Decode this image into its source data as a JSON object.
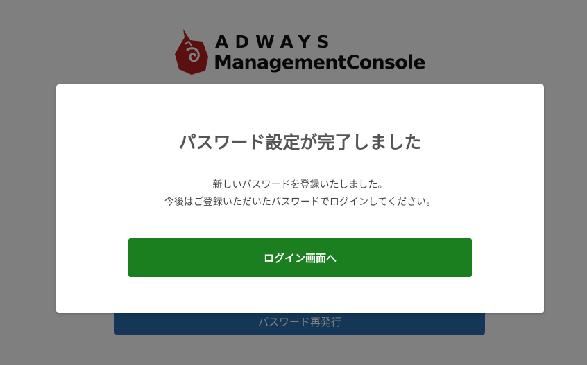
{
  "logo": {
    "brand": "ADWAYS",
    "product": "ManagementConsole",
    "mark_color": "#b5201e",
    "text_color": "#111111"
  },
  "background_page": {
    "reissue_button_label": "パスワード再発行",
    "reissue_button_color": "#2a6fae"
  },
  "modal": {
    "title": "パスワード設定が完了しました",
    "message_line1": "新しいパスワードを登録いたしました。",
    "message_line2": "今後はご登録いただいたパスワードでログインしてください。",
    "login_button_label": "ログイン画面へ",
    "login_button_color": "#1b7f1f"
  },
  "overlay_color": "rgba(0,0,0,0.5)"
}
